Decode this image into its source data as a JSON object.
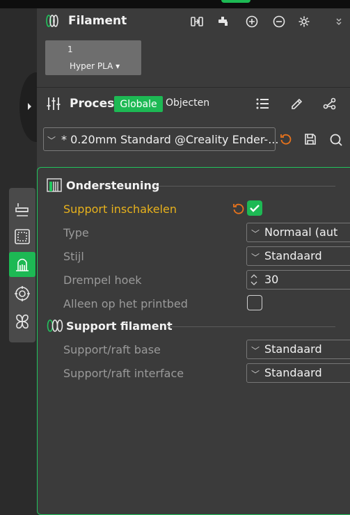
{
  "filament": {
    "title": "Filament",
    "slot_number": "1",
    "slot_name": "Hyper PLA ▾",
    "toolbar_icons": [
      "arrange-icon",
      "tap-icon",
      "add-icon",
      "remove-icon",
      "gear-icon",
      "collapse-icon"
    ]
  },
  "process": {
    "title": "Proces",
    "tab_global": "Globale",
    "tab_objects": "Objecten",
    "preset": "* 0.20mm Standard @Creality Ender-...",
    "toolbar_icons": [
      "list-icon",
      "brush-icon",
      "nodes-icon"
    ]
  },
  "sections": {
    "support": {
      "title": "Ondersteuning",
      "rows": {
        "enable": {
          "label": "Support inschakelen",
          "checked": true
        },
        "type": {
          "label": "Type",
          "value": "Normaal (aut"
        },
        "style": {
          "label": "Stijl",
          "value": "Standaard"
        },
        "threshold": {
          "label": "Drempel hoek",
          "value": "30"
        },
        "build_plate_only": {
          "label": "Alleen op het printbed",
          "checked": false
        }
      }
    },
    "support_filament": {
      "title": "Support filament",
      "rows": {
        "raft_base": {
          "label": "Support/raft base",
          "value": "Standaard"
        },
        "raft_interface": {
          "label": "Support/raft interface",
          "value": "Standaard"
        }
      }
    }
  },
  "sidebar": {
    "icons": [
      "quality-icon",
      "strength-icon",
      "support-icon",
      "others-icon",
      "misc-icon"
    ],
    "selected": "support-icon"
  },
  "colors": {
    "accent": "#1db954",
    "modified": "#e8b21c",
    "reset": "#e8731c",
    "panel": "#3b3b3b"
  }
}
